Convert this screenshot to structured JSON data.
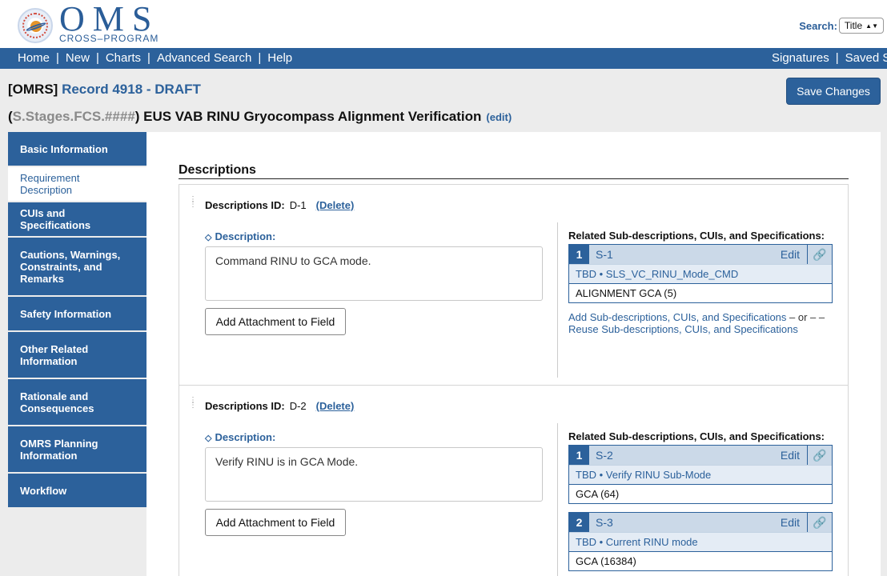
{
  "header": {
    "logo_text": "OMS",
    "logo_subtext": "CROSS–PROGRAM",
    "search_label": "Search:",
    "search_option": "Title"
  },
  "nav": {
    "left": [
      "Home",
      "New",
      "Charts",
      "Advanced Search",
      "Help"
    ],
    "right": [
      "Signatures",
      "Saved S"
    ]
  },
  "record": {
    "prefix": "[OMRS]",
    "title": "Record 4918 - DRAFT",
    "save_label": "Save Changes",
    "paren_open": "(",
    "code": "S.Stages.FCS.####",
    "name": ") EUS VAB RINU Gryocompass Alignment Verification",
    "edit_label": "(edit)"
  },
  "sidebar": [
    {
      "label": "Basic Information",
      "active": false
    },
    {
      "label": "Requirement Description",
      "active": true
    },
    {
      "label": "CUIs and Specifications",
      "active": false
    },
    {
      "label": "Cautions, Warnings, Constraints, and Remarks",
      "active": false
    },
    {
      "label": "Safety Information",
      "active": false
    },
    {
      "label": "Other Related Information",
      "active": false
    },
    {
      "label": "Rationale and Consequences",
      "active": false
    },
    {
      "label": "OMRS Planning Information",
      "active": false
    },
    {
      "label": "Workflow",
      "active": false
    }
  ],
  "main": {
    "heading": "Descriptions",
    "id_label": "Descriptions ID:",
    "delete_label": "(Delete)",
    "description_label": "Description:",
    "attach_label": "Add Attachment to Field",
    "related_label": "Related Sub-descriptions, CUIs, and Specifications:",
    "edit_label": "Edit",
    "add_link": "Add Sub-descriptions, CUIs, and Specifications",
    "or_text": " – or –",
    "reuse_link": "Reuse Sub-descriptions, CUIs, and Specifications",
    "descriptions": [
      {
        "id": "D-1",
        "text": "Command RINU to GCA mode.",
        "specs": [
          {
            "num": "1",
            "id": "S-1",
            "tbd": "TBD • SLS_VC_RINU_Mode_CMD",
            "value": "ALIGNMENT GCA (5)"
          }
        ]
      },
      {
        "id": "D-2",
        "text": "Verify RINU is in GCA Mode.",
        "specs": [
          {
            "num": "1",
            "id": "S-2",
            "tbd": "TBD • Verify RINU Sub-Mode",
            "value": "GCA (64)"
          },
          {
            "num": "2",
            "id": "S-3",
            "tbd": "TBD • Current RINU mode",
            "value": "GCA (16384)"
          }
        ]
      }
    ]
  }
}
